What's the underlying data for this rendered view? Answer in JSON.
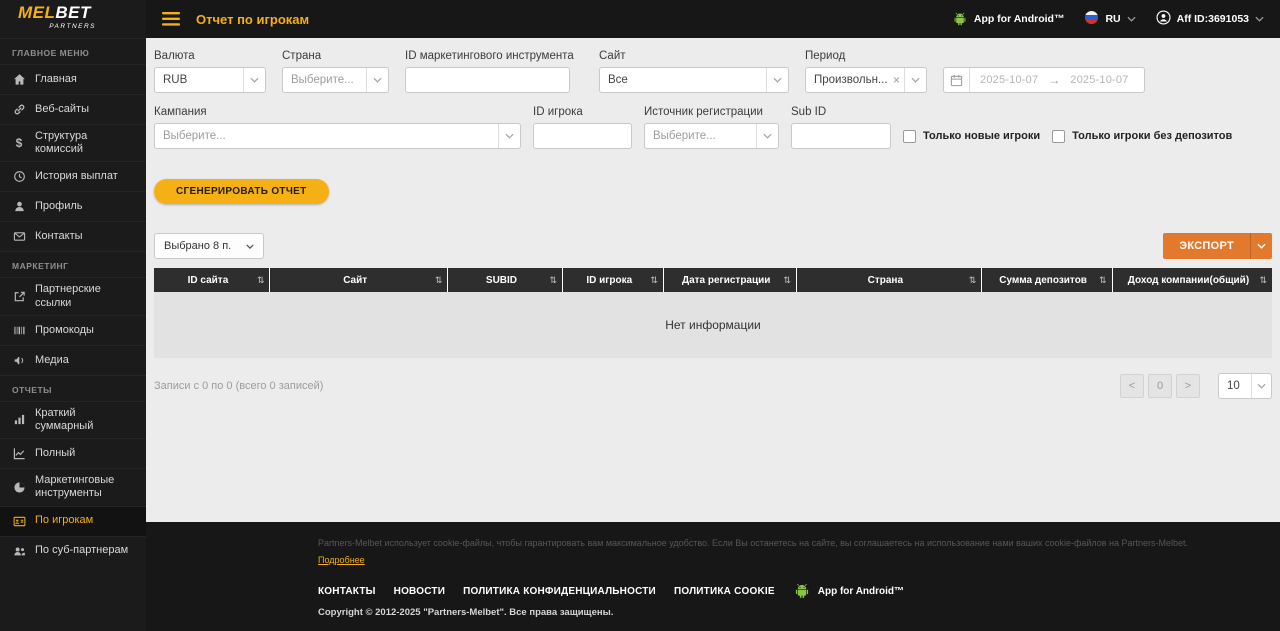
{
  "colors": {
    "accent": "#f4b014",
    "export_orange": "#e2792d",
    "dark": "#171717"
  },
  "icons": {
    "sort": "⇅",
    "clear": "×",
    "date_arrow": "→",
    "dollar": "$"
  },
  "topbar": {
    "title": "Отчет по игрокам",
    "app_link": "App for Android™",
    "lang": "RU",
    "aff_id": "Aff ID:3691053"
  },
  "sidebar": {
    "logo": {
      "part1": "MEL",
      "part2": "BET",
      "sub": "PARTNERS"
    },
    "sections": [
      {
        "label": "ГЛАВНОЕ МЕНЮ",
        "items": [
          {
            "label": "Главная"
          },
          {
            "label": "Веб-сайты"
          },
          {
            "label": "Структура комиссий"
          },
          {
            "label": "История выплат"
          },
          {
            "label": "Профиль"
          },
          {
            "label": "Контакты"
          }
        ]
      },
      {
        "label": "МАРКЕТИНГ",
        "items": [
          {
            "label": "Партнерские ссылки"
          },
          {
            "label": "Промокоды"
          },
          {
            "label": "Медиа"
          }
        ]
      },
      {
        "label": "ОТЧЕТЫ",
        "items": [
          {
            "label": "Краткий суммарный"
          },
          {
            "label": "Полный"
          },
          {
            "label": "Маркетинговые инструменты"
          },
          {
            "label": "По игрокам"
          },
          {
            "label": "По суб-партнерам"
          }
        ]
      }
    ]
  },
  "filters": {
    "currency": {
      "label": "Валюта",
      "value": "RUB"
    },
    "country": {
      "label": "Страна",
      "placeholder": "Выберите..."
    },
    "marketing_id": {
      "label": "ID маркетингового инструмента",
      "value": ""
    },
    "site": {
      "label": "Сайт",
      "value": "Все"
    },
    "period": {
      "label": "Период",
      "value": "Произвольн..."
    },
    "date_from": "2025-10-07",
    "date_to": "2025-10-07",
    "campaign": {
      "label": "Кампания",
      "placeholder": "Выберите..."
    },
    "player_id": {
      "label": "ID игрока",
      "value": ""
    },
    "reg_source": {
      "label": "Источник регистрации",
      "placeholder": "Выберите..."
    },
    "sub_id": {
      "label": "Sub ID",
      "value": ""
    },
    "checkbox_new_players": "Только новые игроки",
    "checkbox_no_deposits": "Только игроки без депозитов",
    "generate_button": "СГЕНЕРИРОВАТЬ ОТЧЕТ"
  },
  "table": {
    "columns_selected": "Выбрано 8 п.",
    "export_button": "ЭКСПОРТ",
    "headers": [
      "ID сайта",
      "Сайт",
      "SUBID",
      "ID игрока",
      "Дата регистрации",
      "Страна",
      "Сумма депозитов",
      "Доход компании(общий)"
    ],
    "empty_text": "Нет информации",
    "records_info": "Записи с 0 по 0 (всего 0 записей)",
    "pagination": {
      "prev": "<",
      "page": "0",
      "next": ">",
      "page_size": "10"
    }
  },
  "footer": {
    "cookie_text": "Partners-Melbet использует cookie-файлы, чтобы гарантировать вам максимальное удобство. Если Вы останетесь на сайте, вы соглашаетесь на использование нами ваших cookie-файлов на Partners-Melbet.",
    "more_link": "Подробнее",
    "links": [
      "КОНТАКТЫ",
      "НОВОСТИ",
      "ПОЛИТИКА КОНФИДЕНЦИАЛЬНОСТИ",
      "ПОЛИТИКА COOKIE"
    ],
    "app_link": "App for Android™",
    "copyright": "Copyright © 2012-2025 \"Partners-Melbet\". Все права защищены."
  }
}
